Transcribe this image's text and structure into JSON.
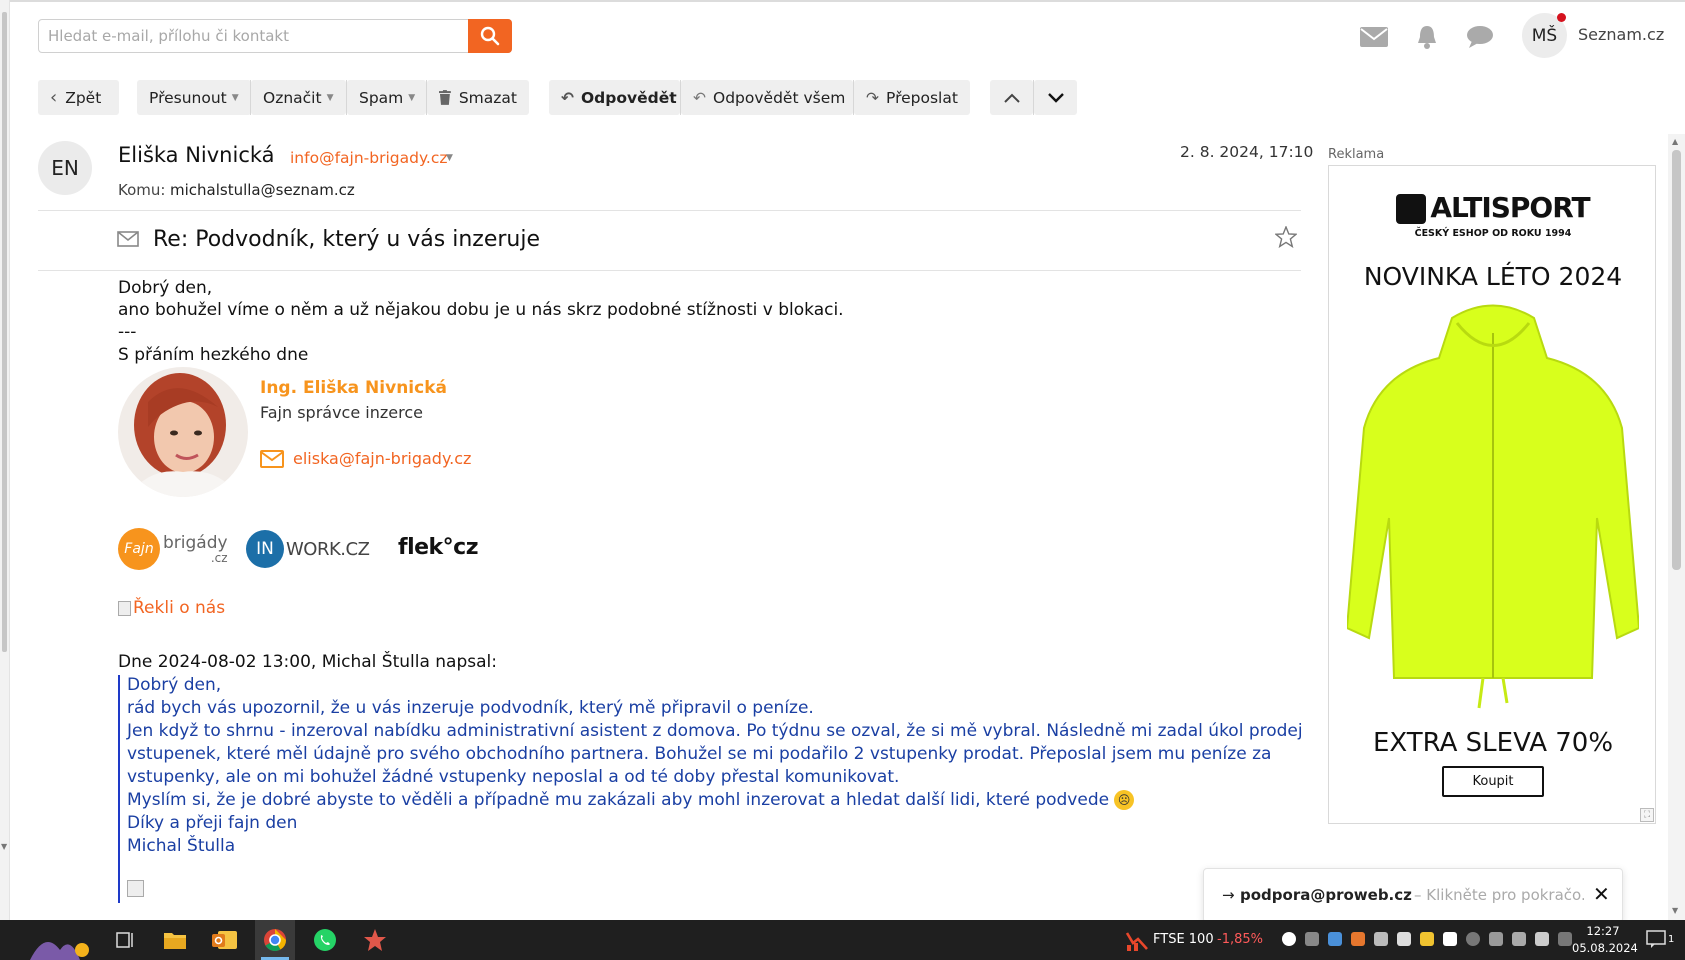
{
  "header": {
    "search_placeholder": "Hledat e-mail, přílohu či kontakt",
    "user_initials": "MŠ",
    "brand_link": "Seznam.cz"
  },
  "toolbar": {
    "back": "Zpět",
    "move": "Přesunout",
    "mark": "Označit",
    "spam": "Spam",
    "delete": "Smazat",
    "reply": "Odpovědět",
    "reply_all": "Odpovědět všem",
    "forward": "Přeposlat"
  },
  "message": {
    "sender_initials": "EN",
    "sender_name": "Eliška Nivnická",
    "sender_email": "info@fajn-brigady.cz",
    "to_label": "Komu:",
    "to_value": "michalstulla@seznam.cz",
    "date": "2. 8. 2024, 17:10",
    "subject": "Re: Podvodník, který u vás inzeruje",
    "body": [
      "Dobrý den,",
      "ano bohužel víme o něm a už nějakou dobu je u nás skrz podobné stížnosti v blokaci.",
      "---",
      "S přáním hezkého dne"
    ],
    "signature": {
      "name": "Ing. Eliška Nivnická",
      "role": "Fajn správce inzerce",
      "email": "eliska@fajn-brigady.cz"
    },
    "logos": {
      "fajn_word": "brigády",
      "fajn_suffix": ".cz",
      "fajn_badge": "Fajn",
      "inwork_badge": "IN",
      "inwork_word": "WORK.CZ",
      "flek": "flek°cz"
    },
    "reklio_alt": "Řekli o nás",
    "quote_header": "Dne 2024-08-02 13:00, Michal Štulla napsal:",
    "quote": [
      "Dobrý den,",
      "rád bych vás upozornil, že u vás inzeruje podvodník, který mě připravil o peníze.",
      "Jen když to shrnu - inzeroval nabídku administrativní asistent z domova. Po týdnu se ozval, že si mě vybral. Následně mi zadal úkol prodej",
      "vstupenek, které měl údajně pro svého obchodního partnera. Bohužel se mi podařilo 2 vstupenky prodat. Přeposlal jsem mu peníze za",
      "vstupenky, ale on mi bohužel žádné vstupenky neposlal a od té doby přestal komunikovat.",
      "Myslím si, že je dobré abyste to věděli a případně mu zakázali aby mohl inzerovat a hledat další lidi, které podvede",
      "Díky a přeji fajn den",
      "Michal  Štulla"
    ]
  },
  "ad": {
    "label": "Reklama",
    "brand": "ALTISPORT",
    "brand_sub": "ČESKÝ ESHOP OD ROKU 1994",
    "headline": "NOVINKA LÉTO 2024",
    "discount": "EXTRA SLEVA 70%",
    "cta": "Koupit"
  },
  "toast": {
    "arrow": "→",
    "email": "podpora@proweb.cz",
    "text": "– Klikněte pro pokračo..."
  },
  "taskbar": {
    "stock_label": "FTSE 100",
    "stock_change": "-1,85%",
    "time": "12:27",
    "date": "05.08.2024",
    "notifications": "1"
  },
  "colors": {
    "accent": "#f26522",
    "quote": "#1a3fa3",
    "ad_jacket": "#d8ff1c"
  }
}
